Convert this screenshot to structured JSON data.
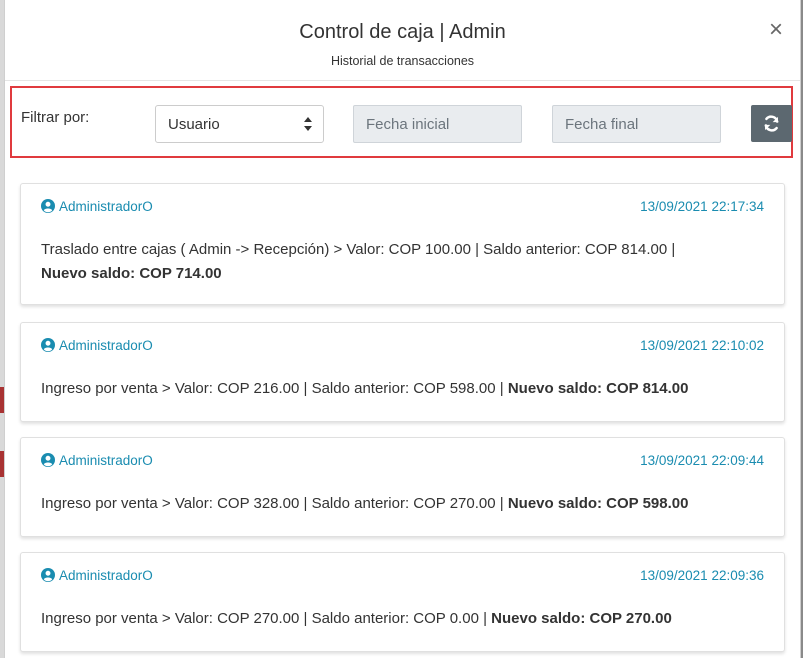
{
  "modal": {
    "title": "Control de caja | Admin",
    "subtitle": "Historial de transacciones",
    "close_label": "×"
  },
  "filter": {
    "label": "Filtrar por:",
    "select_value": "Usuario",
    "start_placeholder": "Fecha inicial",
    "end_placeholder": "Fecha final"
  },
  "transactions": [
    {
      "user": "AdministradorO",
      "time": "13/09/2021 22:17:34",
      "description": "Traslado entre cajas ( Admin -> Recepción)  >  Valor: COP 100.00  |  Saldo anterior: COP 814.00  |",
      "new_balance": "Nuevo saldo: COP 714.00"
    },
    {
      "user": "AdministradorO",
      "time": "13/09/2021 22:10:02",
      "description": "Ingreso por venta  >  Valor: COP 216.00  |  Saldo anterior: COP 598.00  |",
      "new_balance": "Nuevo saldo: COP 814.00"
    },
    {
      "user": "AdministradorO",
      "time": "13/09/2021 22:09:44",
      "description": "Ingreso por venta  >  Valor: COP 328.00  |  Saldo anterior: COP 270.00  |",
      "new_balance": "Nuevo saldo: COP 598.00"
    },
    {
      "user": "AdministradorO",
      "time": "13/09/2021 22:09:36",
      "description": "Ingreso por venta  >  Valor: COP 270.00  |  Saldo anterior: COP 0.00  |",
      "new_balance": "Nuevo saldo: COP 270.00"
    }
  ],
  "colors": {
    "accent_link": "#1a8cb0",
    "highlight_border": "#e03a3e",
    "refresh_button": "#5c6870"
  }
}
